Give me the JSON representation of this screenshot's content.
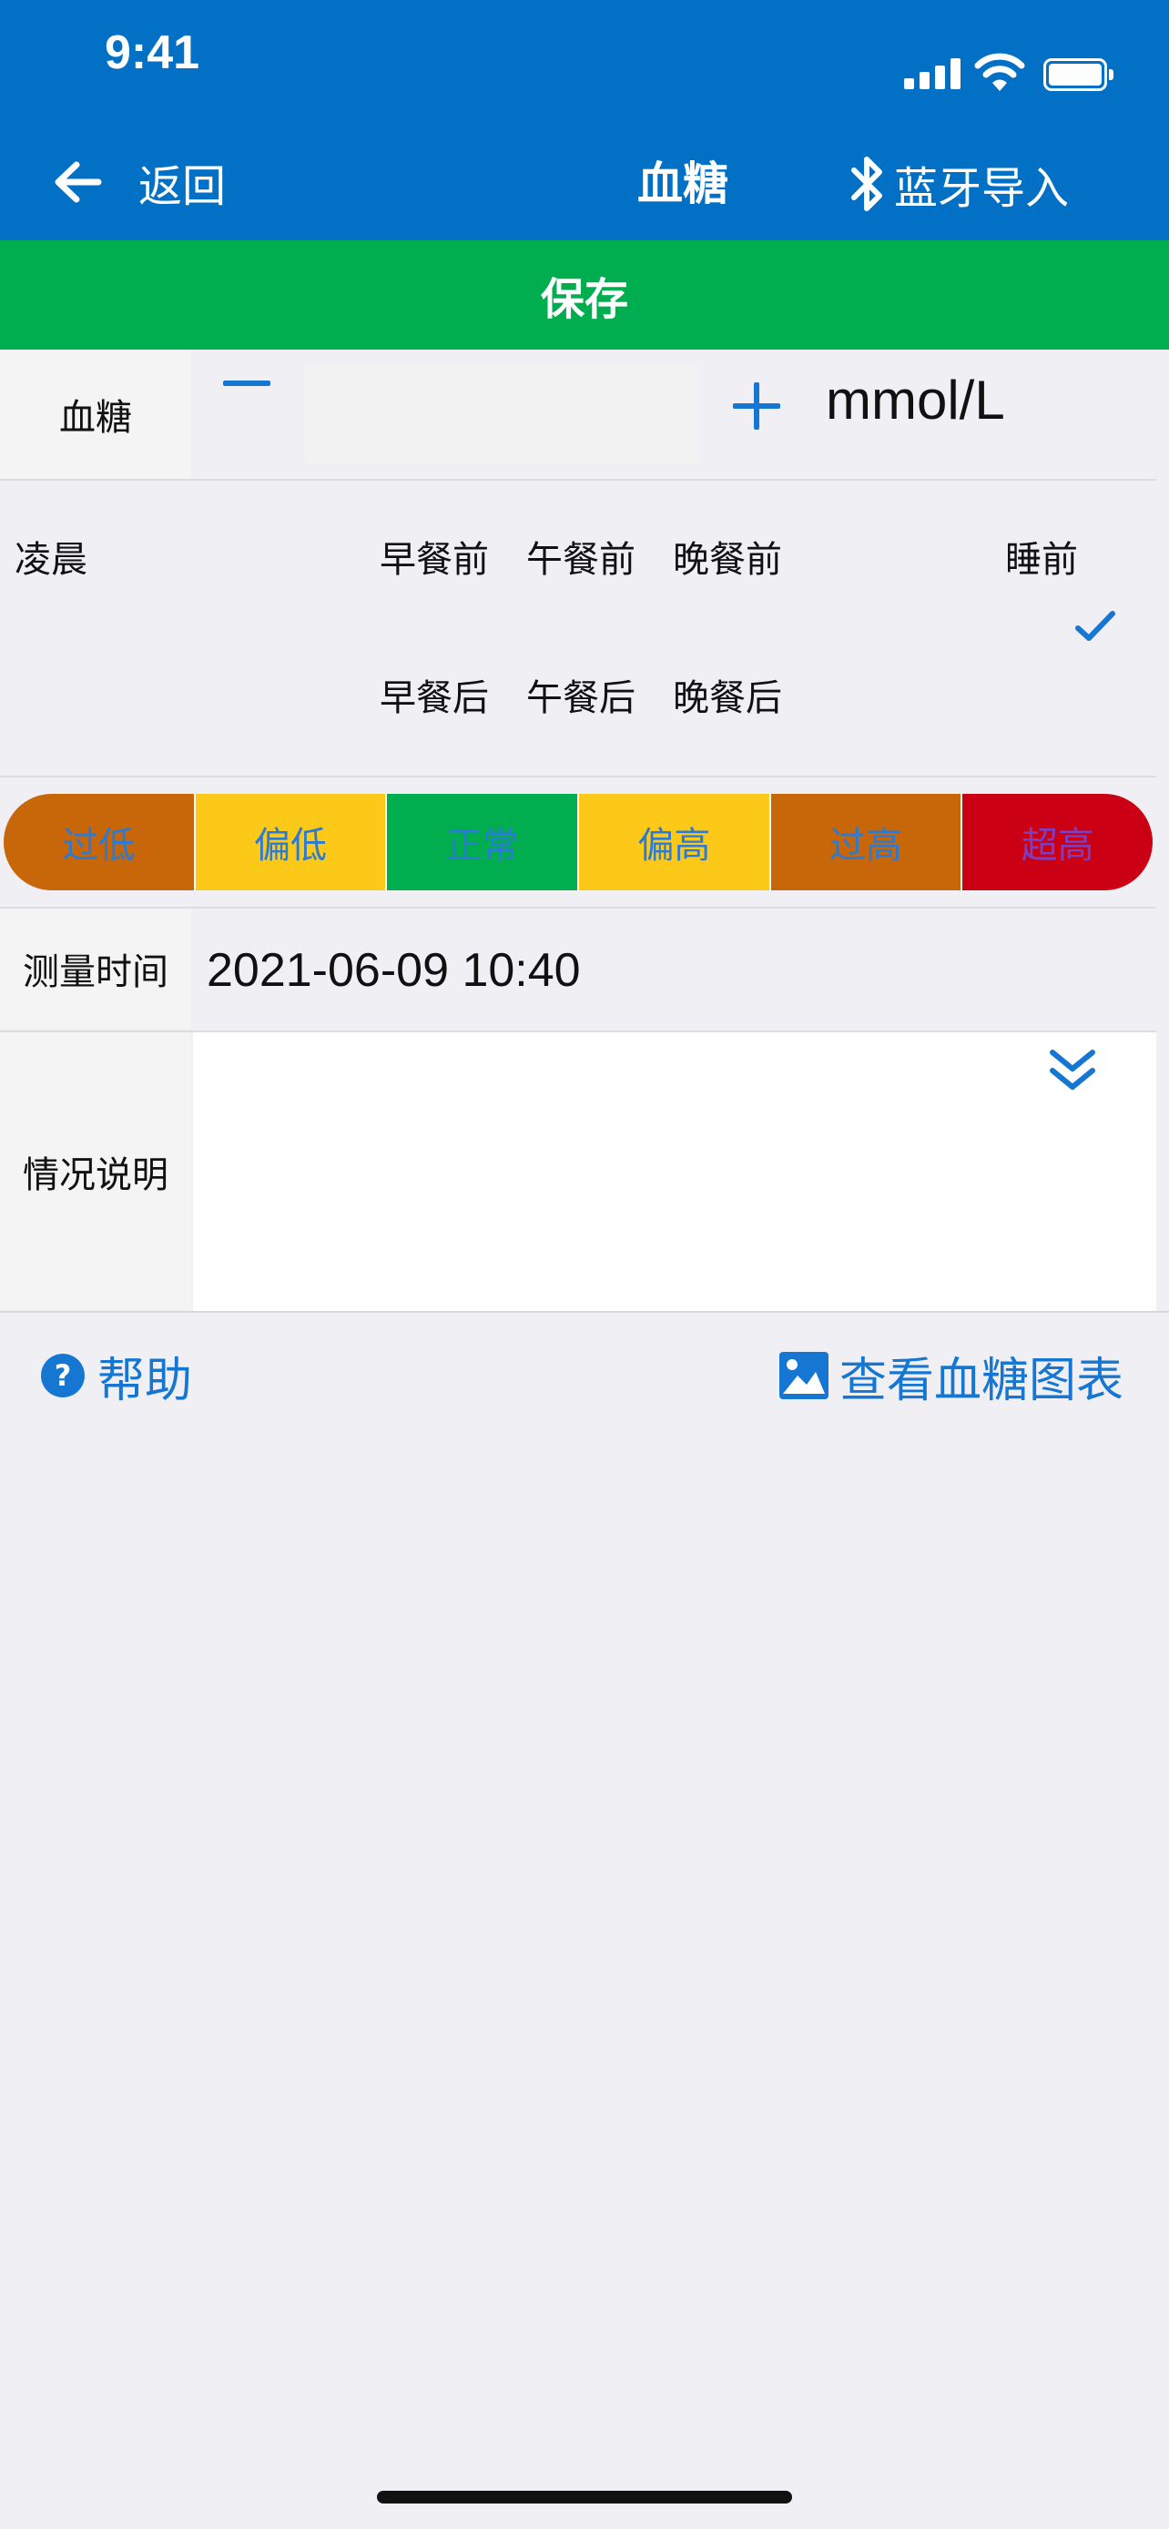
{
  "status_bar": {
    "time": "9:41"
  },
  "nav": {
    "back_label": "返回",
    "title": "血糖",
    "bluetooth_label": "蓝牙导入"
  },
  "toolbar": {
    "save_label": "保存"
  },
  "glucose": {
    "label": "血糖",
    "value": "",
    "unit": "mmol/L"
  },
  "periods": {
    "early_morning": "凌晨",
    "before_breakfast": "早餐前",
    "before_lunch": "午餐前",
    "before_dinner": "晚餐前",
    "before_sleep": "睡前",
    "after_breakfast": "早餐后",
    "after_lunch": "午餐后",
    "after_dinner": "晚餐后",
    "selected": "睡前"
  },
  "levels": [
    {
      "label": "过低",
      "bg": "#c8660a",
      "fg": "#2a7bd6"
    },
    {
      "label": "偏低",
      "bg": "#fcc918",
      "fg": "#2a7bd6"
    },
    {
      "label": "正常",
      "bg": "#00ae50",
      "fg": "#2a7bd6"
    },
    {
      "label": "偏高",
      "bg": "#fcc918",
      "fg": "#2a7bd6"
    },
    {
      "label": "过高",
      "bg": "#c8660a",
      "fg": "#2a7bd6"
    },
    {
      "label": "超高",
      "bg": "#cc0014",
      "fg": "#7a3fc4"
    }
  ],
  "measure_time": {
    "label": "测量时间",
    "value": "2021-06-09 10:40"
  },
  "note": {
    "label": "情况说明",
    "value": ""
  },
  "footer": {
    "help_label": "帮助",
    "help_icon_glyph": "?",
    "chart_label": "查看血糖图表"
  },
  "colors": {
    "primary": "#0270c4",
    "save": "#00ae50",
    "accent": "#1677d2",
    "page_bg": "#efeff4"
  },
  "icons": [
    "back-arrow-icon",
    "bluetooth-icon",
    "checkmark-icon",
    "double-chevron-down-icon",
    "help-icon",
    "image-chart-icon"
  ]
}
